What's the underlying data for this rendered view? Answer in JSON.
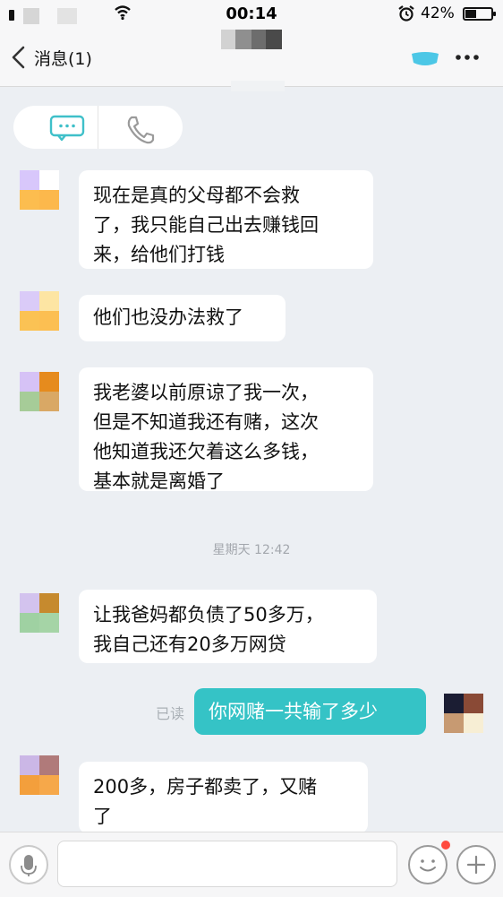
{
  "status_bar": {
    "time": "00:14",
    "battery": "42%"
  },
  "nav": {
    "back_label": "消息(1)"
  },
  "messages": [
    {
      "from": "other",
      "text": "现在是真的父母都不会救了，我只能自己出去赚钱回来，给他们打钱",
      "lines": [
        "现在是真的父母都不会救",
        "了，我只能自己出去赚钱回",
        "来，给他们打钱"
      ]
    },
    {
      "from": "other",
      "text": "他们也没办法救了",
      "lines": [
        "他们也没办法救了"
      ]
    },
    {
      "from": "other",
      "text": "我老婆以前原谅了我一次，但是不知道我还有赌，这次他知道我还欠着这么多钱，基本就是离婚了",
      "lines": [
        "我老婆以前原谅了我一次，",
        "但是不知道我还有赌，这次",
        "他知道我还欠着这么多钱，",
        "基本就是离婚了"
      ]
    },
    {
      "from": "other",
      "text": "让我爸妈都负债了50多万，我自己还有20多万网贷",
      "lines": [
        "让我爸妈都负债了50多万，",
        "我自己还有20多万网贷"
      ]
    },
    {
      "from": "me",
      "text": "你网赌一共输了多少",
      "read_status": "已读"
    },
    {
      "from": "other",
      "text": "200多，房子都卖了，又赌了",
      "lines": [
        "200多，房子都卖了，又赌",
        "了"
      ]
    }
  ],
  "timestamp": "星期天 12:42",
  "input": {
    "value": "",
    "placeholder": ""
  },
  "colors": {
    "accent": "#35c3c6",
    "background": "#eceff3",
    "bubble_other": "#ffffff",
    "badge": "#ff4b3f"
  }
}
